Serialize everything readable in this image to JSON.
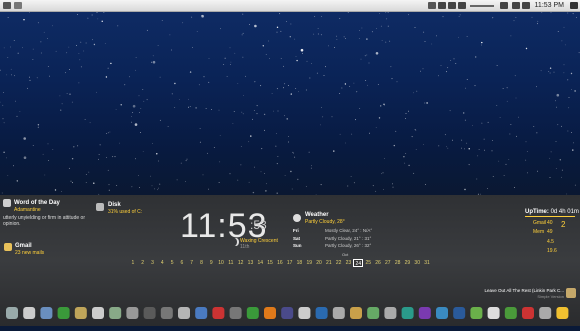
{
  "menubar": {
    "clock": "11:53 PM"
  },
  "word_of_day": {
    "title": "Word of the Day",
    "word": "Adamantine",
    "definition": "utterly unyielding or firm in attitude or opinion."
  },
  "disk": {
    "title": "Disk",
    "usage": "31% used of C:"
  },
  "gmail": {
    "title": "Gmail",
    "count": "23 new mails"
  },
  "clock": {
    "hour": "11",
    "minute": ":53",
    "second": ":53"
  },
  "moon": {
    "phase": "Waxing Crescent",
    "detail": "11th"
  },
  "weather": {
    "title": "Weather",
    "current": "Partly Cloudy, 28°",
    "forecast": [
      {
        "day": "Fri",
        "text": "Mostly Clear, 24° : N/A°"
      },
      {
        "day": "Sat",
        "text": "Partly Cloudy, 21° : 31°"
      },
      {
        "day": "Sun",
        "text": "Partly Cloudy, 26° : 32°"
      }
    ]
  },
  "calendar": {
    "days": [
      "1",
      "2",
      "3",
      "4",
      "5",
      "6",
      "7",
      "8",
      "9",
      "10",
      "11",
      "12",
      "13",
      "14",
      "15",
      "16",
      "17",
      "18",
      "19",
      "20",
      "21",
      "22",
      "23",
      "24",
      "25",
      "26",
      "27",
      "28",
      "29",
      "30",
      "31"
    ],
    "current": "24",
    "month_label": "Oct"
  },
  "uptime": {
    "label": "UpTime:",
    "value": "0d 4h 01m"
  },
  "sysstats": {
    "gmail_label": "Gmail",
    "gmail_val": "40",
    "mem_label": "Mem",
    "mem_val": "49",
    "cpu_val": "2",
    "a_val": "4.5",
    "b_val": "19.6"
  },
  "music": {
    "track": "Leave Out All The Rest (Linkin Park C...",
    "artist": "Simple Version"
  }
}
